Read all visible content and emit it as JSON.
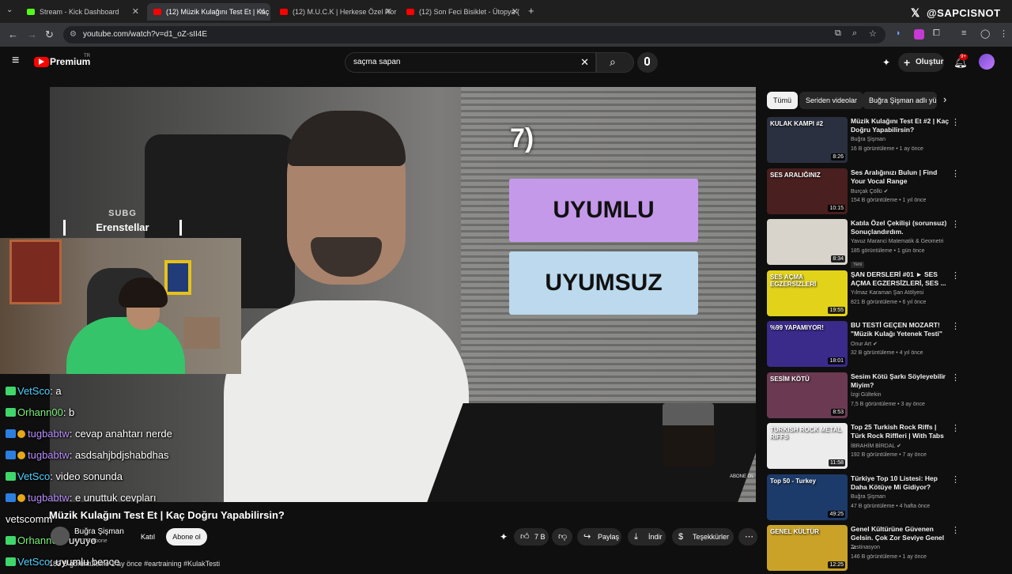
{
  "browser": {
    "tabs": [
      {
        "title": "Stream - Kick Dashboard",
        "favicon_color": "#53fc18",
        "close": "✕"
      },
      {
        "title": "(12) Müzik Kulağını Test Et | Kaç",
        "favicon_color": "#ff0000",
        "close": "✕"
      },
      {
        "title": "(12) M.U.C.K | Herkese Özel Ror",
        "favicon_color": "#ff0000",
        "close": "✕"
      },
      {
        "title": "(12) Son Feci Bisiklet - Ütopya (",
        "favicon_color": "#ff0000",
        "close": "✕"
      }
    ],
    "new_tab": "+",
    "url": "youtube.com/watch?v=d1_oZ-sII4E",
    "watermark": "@SAPCISNOT"
  },
  "youtube": {
    "logo_text": "Premium",
    "logo_region": "TR",
    "search_value": "saçma sapan",
    "create_label": "Oluştur",
    "notif_count": "9+"
  },
  "video": {
    "question_number": "7)",
    "option1": "UYUMLU",
    "option2": "UYUMSUZ",
    "subscribe_mark": "ABONE OL",
    "title": "Müzik Kulağını Test Et | Kaç Doğru Yapabilirsin?",
    "channel": "Buğra Şişman",
    "subscribers": "47,3 B abone",
    "join_label": "Katıl",
    "subscribe_label": "Abone ol",
    "likes": "7 B",
    "share_label": "Paylaş",
    "download_label": "İndir",
    "thanks_label": "Teşekkürler",
    "description_line": "183 B görüntüleme  1 ay önce  #eartraining #KulakTesti"
  },
  "stream_overlay": {
    "sub_label": "SUBG",
    "subscriber_name": "Erenstellar"
  },
  "chat": [
    {
      "user": "VetSco",
      "text": ": a",
      "color": "#4fd1ff",
      "badges": [
        "green"
      ]
    },
    {
      "user": "Orhann00",
      "text": ": b",
      "color": "#7cf07c",
      "badges": [
        "green"
      ]
    },
    {
      "user": "tugbabtw",
      "text": ": cevap anahtarı nerde",
      "color": "#b88cff",
      "badges": [
        "blue",
        "gold"
      ]
    },
    {
      "user": "tugbabtw",
      "text": ": asdsahjbdjshabdhas",
      "color": "#b88cff",
      "badges": [
        "blue",
        "gold"
      ]
    },
    {
      "user": "VetSco",
      "text": ": video sonunda",
      "color": "#4fd1ff",
      "badges": [
        "green"
      ]
    },
    {
      "user": "tugbabtw",
      "text": ": e unuttuk cevpları",
      "color": "#b88cff",
      "badges": [
        "blue",
        "gold"
      ]
    },
    {
      "user": "vetscomm",
      "text": "",
      "color": "#ffffff",
      "badges": []
    },
    {
      "user": "Orhann00",
      "text": ": uyuyo",
      "color": "#7cf07c",
      "badges": [
        "green"
      ]
    },
    {
      "user": "VetSco",
      "text": ": uyumlu bence",
      "color": "#4fd1ff",
      "badges": [
        "green"
      ]
    }
  ],
  "sidebar": {
    "chips": [
      "Tümü",
      "Seriden videolar",
      "Buğra Şişman adlı yü"
    ],
    "videos": [
      {
        "title": "Müzik Kulağını Test Et #2 | Kaç Doğru Yapabilirsin?",
        "channel": "Buğra Şişman",
        "verified": false,
        "meta": "16 B görüntüleme • 1 ay önce",
        "duration": "8:26",
        "thumb_text": "KULAK KAMPI #2",
        "thumb_color": "#2b3040"
      },
      {
        "title": "Ses Aralığınızı Bulun | Find Your Vocal Range",
        "channel": "Burçak Çöllü",
        "verified": true,
        "meta": "154 B görüntüleme • 1 yıl önce",
        "duration": "10:15",
        "thumb_text": "SES ARALIĞINIZ",
        "thumb_color": "#4a1f1f"
      },
      {
        "title": "Katıla Özel Çekilişi (sorunsuz) Sonuçlandırdım.",
        "channel": "Yavuz Maranci Matematik & Geometri",
        "verified": false,
        "meta": "185 görüntüleme • 1 gün önce",
        "duration": "8:34",
        "thumb_text": "",
        "thumb_color": "#d8d4cc",
        "new_tag": "Yeni"
      },
      {
        "title": "ŞAN DERSLERİ #01 ► SES AÇMA EGZERSİZLERİ, SES ...",
        "channel": "Yılmaz Karaman Şan Atölyesi",
        "verified": false,
        "meta": "821 B görüntüleme • 6 yıl önce",
        "duration": "19:55",
        "thumb_text": "SES AÇMA EGZERSİZLERİ",
        "thumb_color": "#e3d21a"
      },
      {
        "title": "BU TESTİ GEÇEN MOZART! \"Müzik Kulağı Yetenek Testi\"",
        "channel": "Onur Art",
        "verified": true,
        "meta": "32 B görüntüleme • 4 yıl önce",
        "duration": "18:01",
        "thumb_text": "%99 YAPAMIYOR!",
        "thumb_color": "#3a2a8a"
      },
      {
        "title": "Sesim Kötü Şarkı Söyleyebilir Miyim?",
        "channel": "İzgi Gültekin",
        "verified": false,
        "meta": "7,5 B görüntüleme • 3 ay önce",
        "duration": "8:53",
        "thumb_text": "SESİM KÖTÜ",
        "thumb_color": "#6b3a52"
      },
      {
        "title": "Top 25 Turkish Rock Riffs | Türk Rock Riffleri | With Tabs",
        "channel": "İBRAHİM BİRDAL",
        "verified": true,
        "meta": "192 B görüntüleme • 7 ay önce",
        "duration": "11:58",
        "thumb_text": "TURKISH ROCK METAL RIFFS",
        "thumb_color": "#ececec"
      },
      {
        "title": "Türkiye Top 10 Listesi: Hep Daha Kötüye Mi Gidiyor?",
        "channel": "Buğra Şişman",
        "verified": false,
        "meta": "47 B görüntüleme • 4 hafta önce",
        "duration": "49:25",
        "thumb_text": "Top 50 - Turkey",
        "thumb_color": "#1d3b6a"
      },
      {
        "title": "Genel Kültürüne Güvenen Gelsin. Çok Zor Seviye Genel ...",
        "channel": "Testinasyon",
        "verified": false,
        "meta": "146 B görüntüleme • 1 ay önce",
        "duration": "12:25",
        "thumb_text": "GENEL KÜLTÜR",
        "thumb_color": "#c9a227"
      }
    ]
  }
}
